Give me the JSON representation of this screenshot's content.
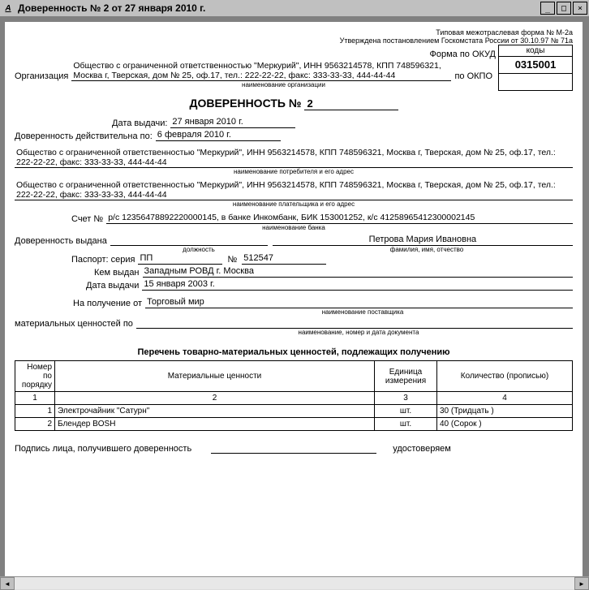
{
  "window": {
    "title": "Доверенность № 2 от 27 января 2010 г."
  },
  "header": {
    "form_line": "Типовая межотраслевая форма № М-2а",
    "approval": "Утверждена постановлением Госкомстата России от 30.10.97 № 71а",
    "okud_label": "Форма по ОКУД",
    "codes_header": "коды",
    "okud_code": "0315001",
    "okpo_label": "по ОКПО",
    "org_label": "Организация",
    "org_value": "Общество с ограниченной ответственностью \"Меркурий\", ИНН 9563214578, КПП 748596321, Москва г, Тверская, дом № 25, оф.17, тел.: 222-22-22, факс: 333-33-33, 444-44-44",
    "org_caption": "наименование организации"
  },
  "title": {
    "word": "ДОВЕРЕННОСТЬ  №",
    "number": "2"
  },
  "dates": {
    "issue_label": "Дата выдачи:",
    "issue_value": "27 января 2010 г.",
    "valid_label": "Доверенность действительна по:",
    "valid_value": "6 февраля 2010 г."
  },
  "consumer": {
    "value": "Общество с ограниченной ответственностью \"Меркурий\", ИНН 9563214578, КПП 748596321, Москва г, Тверская, дом № 25, оф.17, тел.: 222-22-22, факс: 333-33-33, 444-44-44",
    "caption": "наименование потребителя и его адрес"
  },
  "payer": {
    "value": "Общество с ограниченной ответственностью \"Меркурий\", ИНН 9563214578, КПП 748596321, Москва г, Тверская, дом № 25, оф.17, тел.: 222-22-22, факс: 333-33-33, 444-44-44",
    "caption": "наименование плательщика и его адрес"
  },
  "account": {
    "label": "Счет №",
    "value": "р/с 12356478892220000145, в банке Инкомбанк, БИК 153001252, к/с 41258965412300002145",
    "caption": "наименование банка"
  },
  "issued_to": {
    "label": "Доверенность выдана",
    "position_caption": "должность",
    "name": "Петрова Мария Ивановна",
    "name_caption": "фамилия, имя, отчество"
  },
  "passport": {
    "label": "Паспорт: серия",
    "series": "ПП",
    "num_label": "№",
    "number": "512547",
    "issuer_label": "Кем выдан",
    "issuer": "Западным РОВД г. Москва",
    "date_label": "Дата выдачи",
    "date": "15 января 2003 г."
  },
  "receipt": {
    "label": "На получение от",
    "supplier": "Торговый мир",
    "supplier_caption": "наименование поставщика",
    "values_label": "материальных ценностей по",
    "doc_caption": "наименование, номер и дата документа"
  },
  "table": {
    "title": "Перечень товарно-материальных ценностей, подлежащих получению",
    "headers": {
      "num": "Номер по порядку",
      "name": "Материальные ценности",
      "unit": "Единица измерения",
      "qty": "Количество (прописью)"
    },
    "colnums": {
      "c1": "1",
      "c2": "2",
      "c3": "3",
      "c4": "4"
    },
    "rows": [
      {
        "n": "1",
        "name": "Электрочайник \"Сатурн\"",
        "unit": "шт.",
        "qty": "30 (Тридцать )"
      },
      {
        "n": "2",
        "name": "Блендер BOSН",
        "unit": "шт.",
        "qty": "40 (Сорок )"
      }
    ]
  },
  "footer": {
    "sign_label": "Подпись лица, получившего доверенность",
    "attest": "удостоверяем"
  }
}
